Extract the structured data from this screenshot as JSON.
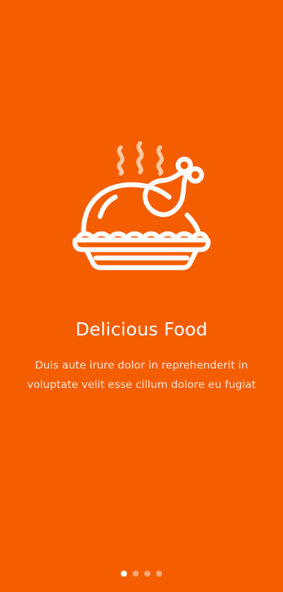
{
  "screen": {
    "background_color": "#F55D01"
  },
  "illustration": {
    "icon": "roast-chicken-icon",
    "stroke_color": "#FFFFFF",
    "steam_color": "#FFC8A0"
  },
  "onboarding": {
    "title": "Delicious Food",
    "description": "Duis aute irure dolor in reprehenderit in voluptate velit esse cillum dolore eu fugiat"
  },
  "pager": {
    "total_pages": 4,
    "active_page": 1
  }
}
